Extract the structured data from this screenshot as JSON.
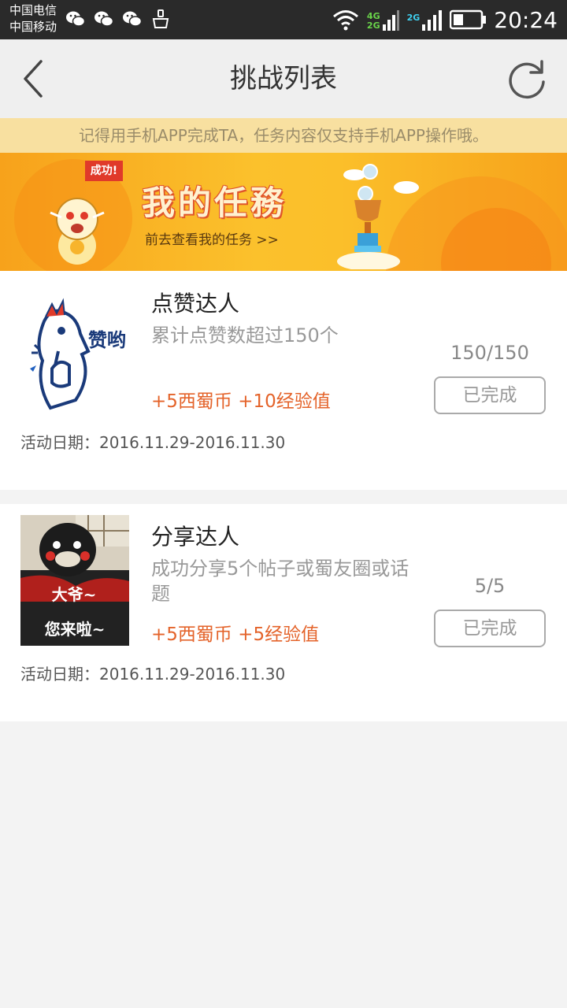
{
  "status_bar": {
    "carrier_1": "中国电信",
    "carrier_2": "中国移动",
    "net_1": "4G",
    "net_2": "2G",
    "net_3": "2G",
    "time": "20:24"
  },
  "header": {
    "title": "挑战列表",
    "back_icon": "chevron-left-icon",
    "refresh_icon": "refresh-icon"
  },
  "notice": "记得用手机APP完成TA，任务内容仅支持手机APP操作哦。",
  "banner": {
    "flag": "成功!",
    "title": "我的任務",
    "subtitle": "前去查看我的任务 >>"
  },
  "tasks": [
    {
      "title": "点赞达人",
      "description": "累计点赞数超过150个",
      "reward": "+5西蜀币 +10经验值",
      "progress": "150/150",
      "status": "已完成",
      "date": "活动日期：2016.11.29-2016.11.30",
      "image_text": "赞哟"
    },
    {
      "title": "分享达人",
      "description": "成功分享5个帖子或蜀友圈或话题",
      "reward": "+5西蜀币 +5经验值",
      "progress": "5/5",
      "status": "已完成",
      "date": "活动日期：2016.11.29-2016.11.30",
      "image_text_1": "大爷~",
      "image_text_2": "您来啦~"
    }
  ],
  "colors": {
    "reward": "#e4632a",
    "banner": "#fbc12c",
    "notice_bg": "#f8e0a0"
  }
}
